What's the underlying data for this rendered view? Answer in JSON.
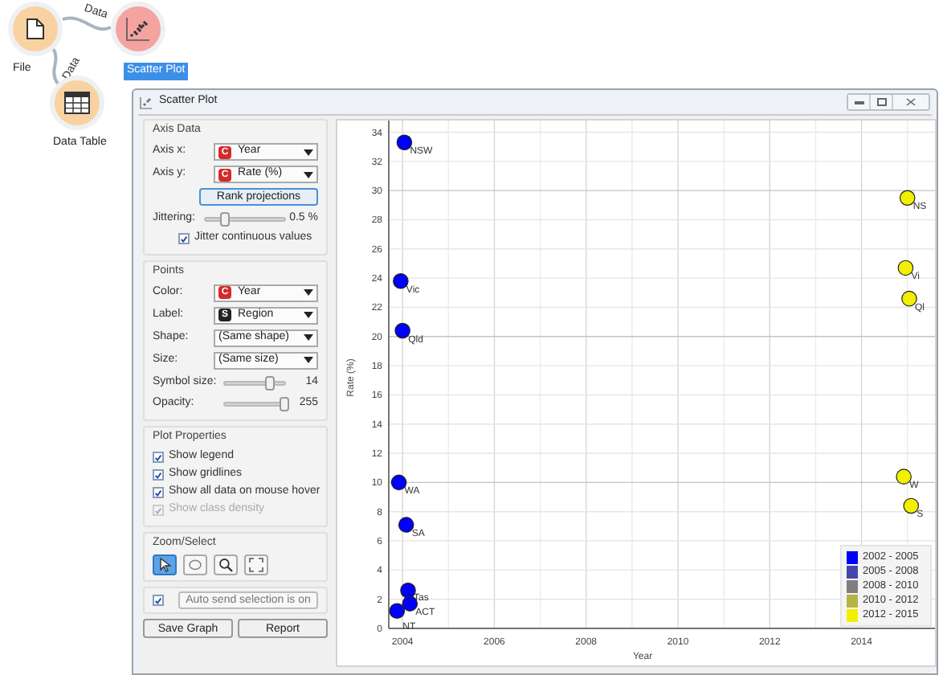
{
  "canvas": {
    "nodes": [
      {
        "label": "File",
        "selected": false,
        "kind": "file"
      },
      {
        "label": "Scatter Plot",
        "selected": true,
        "kind": "scatter"
      },
      {
        "label": "Data Table",
        "selected": false,
        "kind": "table"
      }
    ],
    "links": [
      {
        "label": "Data"
      },
      {
        "label": "Data"
      }
    ]
  },
  "window": {
    "title": "Scatter Plot"
  },
  "axis_data": {
    "title": "Axis Data",
    "combos": [
      {
        "label": "Axis x:",
        "value": "Year",
        "badge": {
          "text": "C",
          "color": "#d42a2a"
        }
      },
      {
        "label": "Axis y:",
        "value": "Rate (%)",
        "badge": {
          "text": "C",
          "color": "#d42a2a"
        }
      }
    ],
    "rank_button": "Rank projections",
    "jittering": {
      "label": "Jittering:",
      "level": 0.25,
      "reading": "0.5 %"
    },
    "jitter_continuous": {
      "label": "Jitter continuous values",
      "checked": true
    }
  },
  "points": {
    "title": "Points",
    "combos": [
      {
        "label": "Color:",
        "value": "Year",
        "badge": {
          "text": "C",
          "color": "#d42a2a"
        }
      },
      {
        "label": "Label:",
        "value": "Region",
        "badge": {
          "text": "S",
          "color": "#222222"
        }
      },
      {
        "label": "Shape:",
        "value": "(Same shape)"
      },
      {
        "label": "Size:",
        "value": "(Same size)"
      }
    ],
    "sliders": [
      {
        "label": "Symbol size:",
        "level": 0.75,
        "reading": "14"
      },
      {
        "label": "Opacity:",
        "level": 1,
        "reading": "255"
      }
    ]
  },
  "plot_properties": {
    "title": "Plot Properties",
    "options": [
      {
        "label": "Show legend",
        "checked": true,
        "disabled": false
      },
      {
        "label": "Show gridlines",
        "checked": true,
        "disabled": false
      },
      {
        "label": "Show all data on mouse hover",
        "checked": true,
        "disabled": false
      },
      {
        "label": "Show class density",
        "checked": true,
        "disabled": true
      }
    ]
  },
  "zoom_select": {
    "title": "Zoom/Select",
    "tools": [
      {
        "kind": "pointer",
        "selected": true
      },
      {
        "kind": "lasso",
        "selected": false
      },
      {
        "kind": "zoom",
        "selected": false
      },
      {
        "kind": "reset",
        "selected": false
      }
    ]
  },
  "auto_send": {
    "checked": true,
    "label": "Auto send selection is on"
  },
  "buttons": [
    "Save Graph",
    "Report"
  ],
  "plot": {
    "chart_data": {
      "type": "scatter",
      "xlabel": "Year",
      "ylabel": "Rate (%)",
      "xlim": [
        2003.7,
        2015.6
      ],
      "ylim": [
        0,
        34.8
      ],
      "grid": true,
      "legend": "lower right",
      "xticks": [
        2004,
        2006,
        2008,
        2010,
        2012,
        2014
      ],
      "yticks": [
        0,
        2,
        4,
        6,
        8,
        10,
        12,
        14,
        16,
        18,
        20,
        22,
        24,
        26,
        28,
        30,
        32,
        34
      ],
      "series": [
        {
          "name": "2002 - 2005",
          "color": "#0000ff",
          "x": [
            2004.04,
            2003.96,
            2004.0,
            2003.92,
            2004.08,
            2004.12,
            2004.16,
            2003.88
          ],
          "values": [
            33.3,
            23.8,
            20.4,
            10,
            7.1,
            2.6,
            1.7,
            1.2
          ]
        },
        {
          "name": "2005 - 2008",
          "color": "#4646aa"
        },
        {
          "name": "2008 - 2010",
          "color": "#7f7f7f"
        },
        {
          "name": "2010 - 2012",
          "color": "#b4b444"
        },
        {
          "name": "2012 - 2015",
          "color": "#f0f000",
          "x": [
            2015.0,
            2014.96,
            2015.04,
            2014.92,
            2015.08
          ],
          "values": [
            29.5,
            24.7,
            22.6,
            10.4,
            8.4
          ]
        }
      ],
      "annotations": [
        {
          "x": 2004.04,
          "y": 33.3,
          "text": "NSW"
        },
        {
          "x": 2003.96,
          "y": 23.8,
          "text": "Vic"
        },
        {
          "x": 2004.0,
          "y": 20.4,
          "text": "Qld"
        },
        {
          "x": 2003.92,
          "y": 10,
          "text": "WA"
        },
        {
          "x": 2004.08,
          "y": 7.1,
          "text": "SA"
        },
        {
          "x": 2004.12,
          "y": 2.7,
          "text": "Tas"
        },
        {
          "x": 2004.16,
          "y": 1.7,
          "text": "ACT"
        },
        {
          "x": 2003.88,
          "y": 0.7,
          "text": "NT"
        },
        {
          "x": 2015.0,
          "y": 29.5,
          "text": "NS"
        },
        {
          "x": 2014.96,
          "y": 24.7,
          "text": "Vi"
        },
        {
          "x": 2015.04,
          "y": 22.6,
          "text": "Ql"
        },
        {
          "x": 2014.92,
          "y": 10.4,
          "text": "W"
        },
        {
          "x": 2015.08,
          "y": 8.4,
          "text": "S"
        }
      ]
    }
  }
}
